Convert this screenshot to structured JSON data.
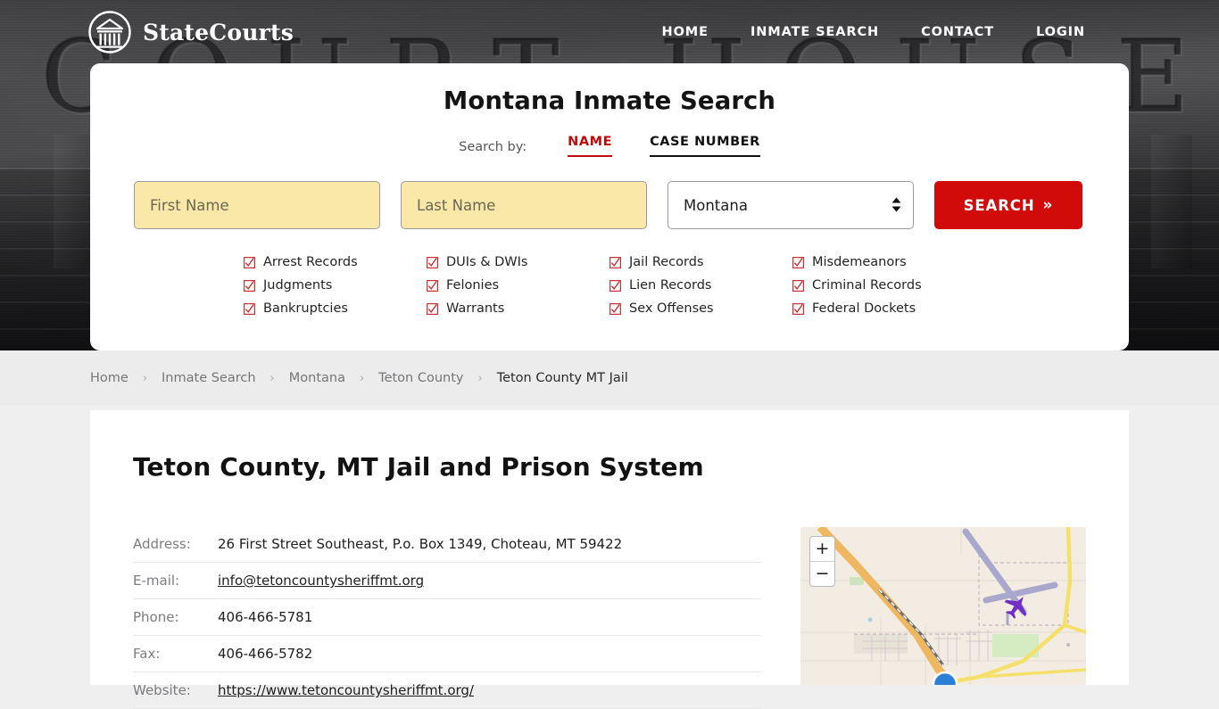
{
  "header": {
    "brand_name": "StateCourts",
    "logo_icon": "courthouse-circle-icon",
    "background_word": "COURT HOUSE",
    "nav": [
      {
        "label": "HOME"
      },
      {
        "label": "INMATE SEARCH"
      },
      {
        "label": "CONTACT"
      },
      {
        "label": "LOGIN"
      }
    ]
  },
  "search_card": {
    "title": "Montana Inmate Search",
    "search_by_label": "Search by:",
    "tabs": [
      {
        "label": "NAME",
        "active": true
      },
      {
        "label": "CASE NUMBER",
        "active": false
      }
    ],
    "first_name_placeholder": "First Name",
    "first_name_value": "",
    "last_name_placeholder": "Last Name",
    "last_name_value": "",
    "state_selected": "Montana",
    "state_options": [
      "Montana"
    ],
    "search_button_label": "SEARCH",
    "search_button_icon": "double-chevron-right-icon",
    "record_types": [
      "Arrest Records",
      "DUIs & DWIs",
      "Jail Records",
      "Misdemeanors",
      "Judgments",
      "Felonies",
      "Lien Records",
      "Criminal Records",
      "Bankruptcies",
      "Warrants",
      "Sex Offenses",
      "Federal Dockets"
    ],
    "checkbox_icon": "checked-checkbox-icon",
    "colors": {
      "accent_red": "#d10a0a",
      "tab_active_red": "#c00a0a",
      "input_yellow": "#fae8a8"
    }
  },
  "breadcrumb": {
    "separator": "›",
    "items": [
      {
        "label": "Home",
        "active": false
      },
      {
        "label": "Inmate Search",
        "active": false
      },
      {
        "label": "Montana",
        "active": false
      },
      {
        "label": "Teton County",
        "active": false
      },
      {
        "label": "Teton County MT Jail",
        "active": true
      }
    ]
  },
  "main": {
    "page_title": "Teton County, MT Jail and Prison System",
    "details": [
      {
        "key": "Address:",
        "value": "26 First Street Southeast, P.o. Box 1349, Choteau, MT 59422",
        "link": false
      },
      {
        "key": "E-mail:",
        "value": "info@tetoncountysheriffmt.org",
        "link": true
      },
      {
        "key": "Phone:",
        "value": "406-466-5781",
        "link": false
      },
      {
        "key": "Fax:",
        "value": "406-466-5782",
        "link": false
      },
      {
        "key": "Website:",
        "value": "https://www.tetoncountysheriffmt.org/",
        "link": true
      }
    ]
  },
  "map": {
    "zoom_in_label": "+",
    "zoom_out_label": "−",
    "zoom_in_icon": "plus-icon",
    "zoom_out_icon": "minus-icon",
    "marker_icon": "location-marker-icon",
    "airport_icon": "airplane-icon"
  }
}
